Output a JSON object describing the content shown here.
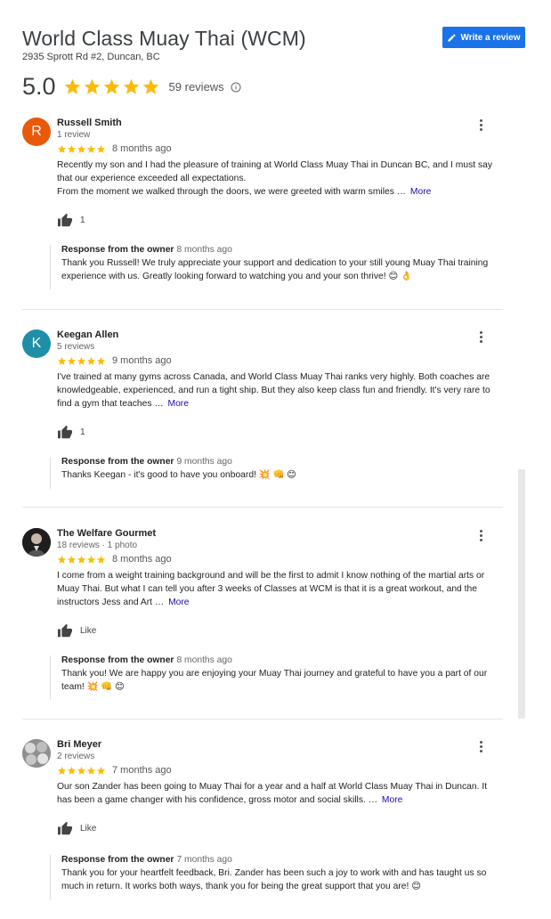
{
  "business": {
    "name": "World Class Muay Thai (WCM)",
    "address": "2935 Sprott Rd #2, Duncan, BC",
    "rating": "5.0",
    "rating_value": 5,
    "review_count": "59 reviews",
    "write_review_label": "Write a review"
  },
  "colors": {
    "star": "#fbbc04",
    "accent": "#1a73e8",
    "link": "#1a0dab"
  },
  "icons": {
    "write": "pencil-icon",
    "info": "info-icon",
    "menu": "more-vert-icon",
    "like": "thumbs-up-icon",
    "star": "star-icon"
  },
  "reviews": [
    {
      "initial": "R",
      "avatar_color": "#e8590c",
      "name": "Russell Smith",
      "meta": "1 review",
      "stars": 5,
      "date": "8 months ago",
      "text1": "Recently my son and I had the pleasure of training at World Class Muay Thai in Duncan BC, and I must say that our experience exceeded all expectations.",
      "text2": "From the moment we walked through the doors, we were greeted with warm smiles …",
      "more": "More",
      "likes": "1",
      "owner_label": "Response from the owner",
      "owner_date": "8 months ago",
      "owner_text": "Thank you Russell! We truly appreciate your support and dedication to your still young Muay Thai training experience with us. Greatly looking forward to watching you and your son thrive! 😊 👌"
    },
    {
      "initial": "K",
      "avatar_color": "#1f8fa8",
      "name": "Keegan Allen",
      "meta": "5 reviews",
      "stars": 5,
      "date": "9 months ago",
      "text1": "I've trained at many gyms across Canada, and World Class Muay Thai ranks very highly. Both coaches are knowledgeable, experienced, and run a tight ship. But they also keep class fun and friendly. It's very rare to find a gym that teaches …",
      "text2": "",
      "more": "More",
      "likes": "1",
      "owner_label": "Response from the owner",
      "owner_date": "9 months ago",
      "owner_text": "Thanks Keegan - it's good to have you onboard! 💥 👊 😊"
    },
    {
      "initial": "",
      "avatar_color": "#2b2b2b",
      "name": "The Welfare Gourmet",
      "meta": "18 reviews · 1 photo",
      "stars": 5,
      "date": "8 months ago",
      "text1": "I come from a weight training background and will be the first to admit I know nothing of the martial arts or Muay Thai. But what I can tell you after 3 weeks of Classes at WCM is that it is a great workout, and the instructors Jess and Art …",
      "text2": "",
      "more": "More",
      "likes": "Like",
      "owner_label": "Response from the owner",
      "owner_date": "8 months ago",
      "owner_text": "Thank you! We are happy you are enjoying your Muay Thai journey and grateful to have you a part of our team! 💥 👊 😊"
    },
    {
      "initial": "",
      "avatar_color": "#9a9a9a",
      "name": "Bri Meyer",
      "meta": "2 reviews",
      "stars": 5,
      "date": "7 months ago",
      "text1": "Our son Zander has been going to Muay Thai for a year and a half at World Class Muay Thai in Duncan. It has been a game changer with his confidence, gross motor and social skills. …",
      "text2": "",
      "more": "More",
      "likes": "Like",
      "owner_label": "Response from the owner",
      "owner_date": "7 months ago",
      "owner_text": "Thank you for your heartfelt feedback, Bri. Zander has been such a joy to work with and has taught us so much in return. It works both ways, thank you for being the great support that you are! 😊"
    }
  ]
}
